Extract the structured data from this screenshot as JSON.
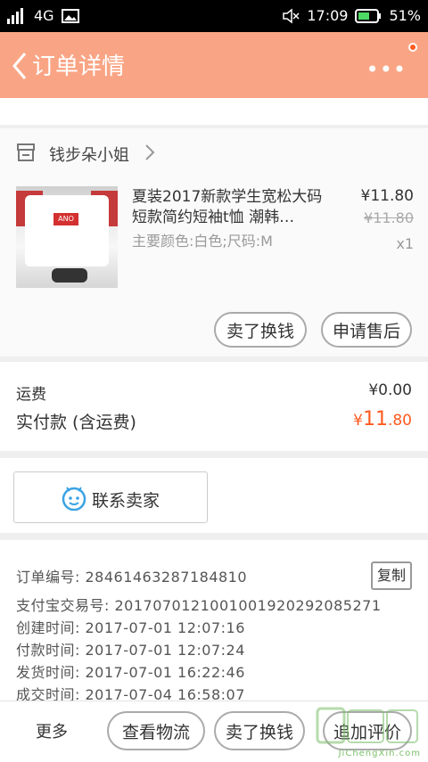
{
  "status_bar": {
    "network": "4G",
    "time": "17:09",
    "battery": "51%"
  },
  "header": {
    "title": "订单详情",
    "more_icon": "more-dots-icon"
  },
  "shop": {
    "name": "钱步朵小姐"
  },
  "item": {
    "title": "夏装2017新款学生宽松大码短款简约短袖t恤 潮韩…",
    "variant": "主要颜色:白色;尺码:M",
    "price": "¥11.80",
    "original_price": "¥11.80",
    "quantity": "x1",
    "buttons": {
      "swap": "卖了换钱",
      "after_sale": "申请售后"
    }
  },
  "totals": {
    "shipping_label": "运费",
    "shipping_value": "¥0.00",
    "paid_label": "实付款 (含运费)",
    "paid_currency": "¥",
    "paid_int": "11",
    "paid_dec": ".80"
  },
  "contact": {
    "label": "联系卖家"
  },
  "order_info": {
    "order_no": "订单编号: 28461463287184810",
    "copy_label": "复制",
    "alipay_no": "支付宝交易号: 2017070121001001920292085271",
    "created": "创建时间: 2017-07-01 12:07:16",
    "paid": "付款时间: 2017-07-01 12:07:24",
    "shipped": "发货时间: 2017-07-01 16:22:46",
    "completed": "成交时间: 2017-07-04 16:58:07"
  },
  "bottom_bar": {
    "more": "更多",
    "logistics": "查看物流",
    "swap": "卖了换钱",
    "review": "追加评价"
  },
  "watermark": {
    "text": "JiChengXin.com"
  },
  "colors": {
    "header_bg": "#f9a585",
    "price_accent": "#ff5a1f",
    "page_bg": "#efefef"
  }
}
